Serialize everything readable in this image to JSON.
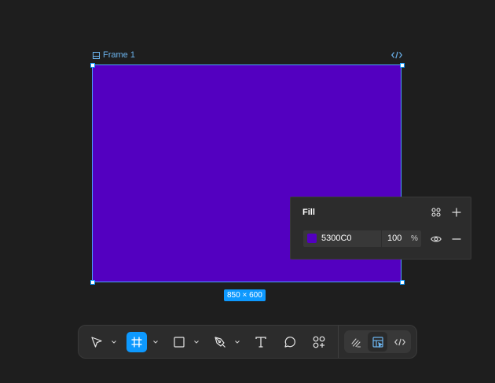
{
  "frame": {
    "label": "Frame 1",
    "fill_color": "#5300C0",
    "size_label": "850 × 600"
  },
  "fill_panel": {
    "title": "Fill",
    "hex": "5300C0",
    "opacity": "100",
    "opacity_unit": "%",
    "icons": [
      "styles-grid-icon",
      "plus-icon",
      "eye-icon",
      "minus-icon"
    ]
  },
  "toolbar": {
    "tools": [
      {
        "name": "move-tool",
        "icon": "cursor-icon",
        "active": false
      },
      {
        "name": "frame-tool",
        "icon": "hash-frame-icon",
        "active": true
      },
      {
        "name": "rectangle-tool",
        "icon": "square-icon",
        "active": false
      },
      {
        "name": "pen-tool",
        "icon": "pen-nib-icon",
        "active": false
      },
      {
        "name": "text-tool",
        "icon": "text-T-icon",
        "active": false
      },
      {
        "name": "comment-tool",
        "icon": "speech-bubble-icon",
        "active": false
      },
      {
        "name": "actions-tool",
        "icon": "shapes-plus-icon",
        "active": false
      }
    ],
    "modes": [
      {
        "name": "draw-mode",
        "icon": "pencil-lines-icon",
        "active": false
      },
      {
        "name": "design-mode",
        "icon": "design-layout-icon",
        "active": true
      },
      {
        "name": "dev-mode",
        "icon": "code-icon",
        "active": false
      }
    ],
    "accent": "#0d99ff"
  }
}
